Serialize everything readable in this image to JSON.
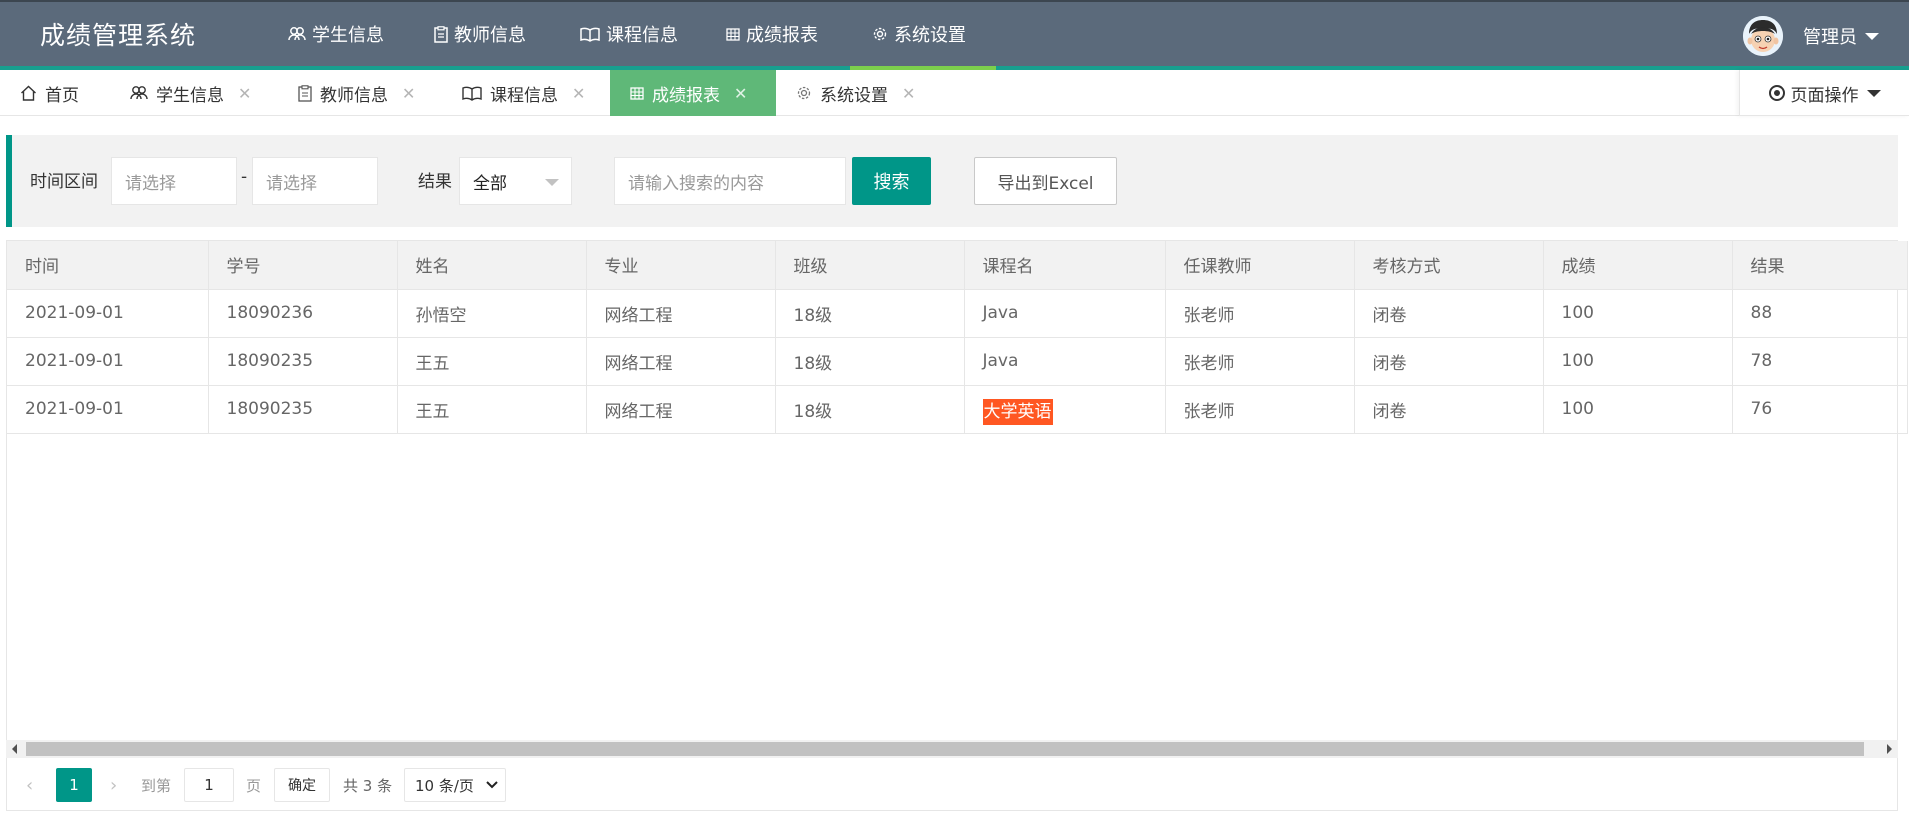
{
  "app": {
    "title": "成绩管理系统"
  },
  "topnav": [
    {
      "label": "学生信息",
      "icon": "users-icon"
    },
    {
      "label": "教师信息",
      "icon": "clipboard-icon"
    },
    {
      "label": "课程信息",
      "icon": "book-icon"
    },
    {
      "label": "成绩报表",
      "icon": "table-icon"
    },
    {
      "label": "系统设置",
      "icon": "gear-icon"
    }
  ],
  "user": {
    "name": "管理员"
  },
  "tabs": [
    {
      "label": "首页",
      "icon": "home-icon"
    },
    {
      "label": "学生信息",
      "icon": "users-icon"
    },
    {
      "label": "教师信息",
      "icon": "clipboard-icon"
    },
    {
      "label": "课程信息",
      "icon": "book-icon"
    },
    {
      "label": "成绩报表",
      "icon": "table-icon",
      "active": true
    },
    {
      "label": "系统设置",
      "icon": "gear-icon"
    }
  ],
  "page_ops": {
    "label": "页面操作"
  },
  "search": {
    "time_label": "时间区间",
    "start_placeholder": "请选择",
    "sep": "-",
    "end_placeholder": "请选择",
    "result_label": "结果",
    "result_value": "全部",
    "keyword_placeholder": "请输入搜索的内容",
    "search_button": "搜索",
    "export_button": "导出到Excel"
  },
  "table": {
    "columns": [
      "时间",
      "学号",
      "姓名",
      "专业",
      "班级",
      "课程名",
      "任课教师",
      "考核方式",
      "成绩",
      "结果"
    ],
    "rows": [
      [
        "2021-09-01",
        "18090236",
        "孙悟空",
        "网络工程",
        "18级",
        "Java",
        "张老师",
        "闭卷",
        "100",
        "88"
      ],
      [
        "2021-09-01",
        "18090235",
        "王五",
        "网络工程",
        "18级",
        "Java",
        "张老师",
        "闭卷",
        "100",
        "78"
      ],
      [
        "2021-09-01",
        "18090235",
        "王五",
        "网络工程",
        "18级",
        "大学英语",
        "张老师",
        "闭卷",
        "100",
        "76"
      ]
    ]
  },
  "pager": {
    "current": "1",
    "goto_label": "到第",
    "goto_value": "1",
    "page_unit": "页",
    "confirm": "确定",
    "total": "共 3 条",
    "page_size": "10 条/页"
  },
  "colors": {
    "header": "#5b6a7b",
    "accent": "#009688",
    "active_tab": "#5fb878",
    "highlight": "#ff5722"
  }
}
